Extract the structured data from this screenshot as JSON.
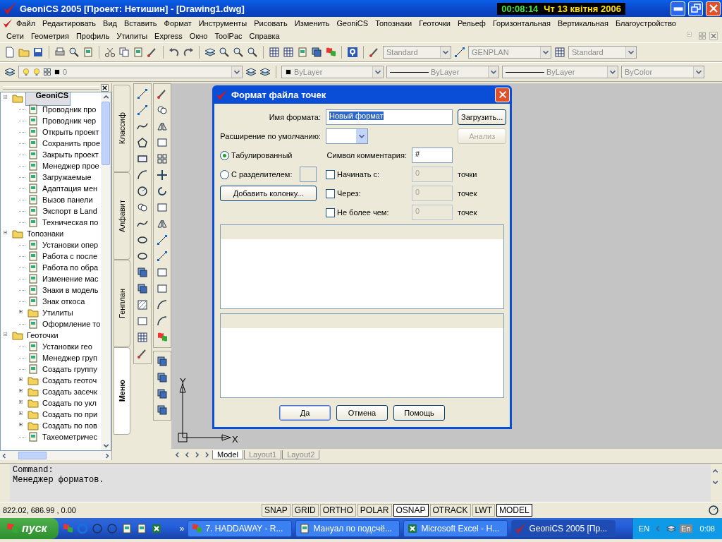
{
  "title_bar": {
    "title": "GeoniCS 2005 [Проект: Нетишин] - [Drawing1.dwg]",
    "clock_time": "00:08:14",
    "clock_date": "Чт 13 квітня 2006"
  },
  "menu_rows": [
    [
      "Файл",
      "Редактировать",
      "Вид",
      "Вставить",
      "Формат",
      "Инструменты",
      "Рисовать",
      "Изменить",
      "GeoniCS",
      "Топознаки",
      "Геоточки",
      "Рельеф",
      "Горизонтальная",
      "Вертикальная",
      "Благоустройство"
    ],
    [
      "Сети",
      "Геометрия",
      "Профиль",
      "Утилиты",
      "Express",
      "Окно",
      "ToolPac",
      "Справка"
    ]
  ],
  "toolbar": {
    "text_style": "Standard",
    "dim_style": "GENPLAN",
    "table_style": "Standard"
  },
  "layers_bar": {
    "layer": "0",
    "color_setting": "ByLayer",
    "linetype": "ByLayer",
    "lineweight": "ByLayer",
    "plot_style": "ByColor"
  },
  "tree": [
    {
      "label": "GeoniCS",
      "kind": "folder",
      "selected": true,
      "expanded": true,
      "children": [
        {
          "label": "Проводник про",
          "kind": "item",
          "selected": false
        },
        {
          "label": "Проводник чер",
          "kind": "item",
          "selected": false
        },
        {
          "label": "Открыть проект",
          "kind": "item",
          "selected": false
        },
        {
          "label": "Сохранить прое",
          "kind": "item",
          "selected": false
        },
        {
          "label": "Закрыть проект",
          "kind": "item",
          "selected": false
        },
        {
          "label": "Менеджер прое",
          "kind": "item",
          "selected": false
        },
        {
          "label": "Загружаемые",
          "kind": "item",
          "selected": false
        },
        {
          "label": "Адаптация мен",
          "kind": "item",
          "selected": false
        },
        {
          "label": "Вызов панели",
          "kind": "item",
          "selected": false
        },
        {
          "label": "Экспорт в Land",
          "kind": "item",
          "selected": false
        },
        {
          "label": "Техническая по",
          "kind": "item",
          "selected": false
        }
      ]
    },
    {
      "label": "Топознаки",
      "kind": "folder",
      "selected": false,
      "expanded": true,
      "children": [
        {
          "label": "Установки опер",
          "kind": "item",
          "selected": false
        },
        {
          "label": "Работа с после",
          "kind": "item",
          "selected": false
        },
        {
          "label": "Работа по обра",
          "kind": "item",
          "selected": false
        },
        {
          "label": "Изменение мас",
          "kind": "item",
          "selected": false
        },
        {
          "label": "Знаки в модель",
          "kind": "item",
          "selected": false
        },
        {
          "label": "Знак откоса",
          "kind": "item",
          "selected": false
        },
        {
          "label": "Утилиты",
          "kind": "folder",
          "selected": false,
          "expanded": false
        },
        {
          "label": "Оформление то",
          "kind": "item",
          "selected": false
        }
      ]
    },
    {
      "label": "Геоточки",
      "kind": "folder",
      "selected": false,
      "expanded": true,
      "children": [
        {
          "label": "Установки гео",
          "kind": "item",
          "selected": false
        },
        {
          "label": "Менеджер груп",
          "kind": "item",
          "selected": false
        },
        {
          "label": "Создать группу",
          "kind": "item",
          "selected": false
        },
        {
          "label": "Создать геоточ",
          "kind": "folder",
          "selected": false,
          "expanded": false
        },
        {
          "label": "Создать засечк",
          "kind": "folder",
          "selected": false,
          "expanded": false
        },
        {
          "label": "Создать по укл",
          "kind": "folder",
          "selected": false,
          "expanded": false
        },
        {
          "label": "Создать по при",
          "kind": "folder",
          "selected": false,
          "expanded": false
        },
        {
          "label": "Создать по пов",
          "kind": "folder",
          "selected": false,
          "expanded": false
        },
        {
          "label": "Тахеометричес",
          "kind": "item",
          "selected": false
        }
      ]
    }
  ],
  "side_tabs": [
    {
      "label": "Классиф",
      "selected": false
    },
    {
      "label": "Алфавит",
      "selected": false
    },
    {
      "label": "Генплан",
      "selected": false
    },
    {
      "label": "Меню",
      "selected": true
    }
  ],
  "canvas": {
    "ucs_y": "Y",
    "ucs_x": "X"
  },
  "layout_tabs": [
    {
      "label": "Model",
      "selected": true
    },
    {
      "label": "Layout1",
      "selected": false
    },
    {
      "label": "Layout2",
      "selected": false
    }
  ],
  "dialog": {
    "title": "Формат файла точек",
    "name_label": "Имя формата:",
    "name_value": "Новый формат",
    "name_selected": true,
    "load_button": "Загрузить...",
    "analyze_button": {
      "label": "Анализ",
      "disabled": true
    },
    "ext_label": "Расширение по умолчанию:",
    "format_options": [
      {
        "label": "Табулированный",
        "selected": true
      },
      {
        "label": "С разделителем:",
        "selected": false
      }
    ],
    "comment_label": "Символ комментария:",
    "comment_value": "#",
    "add_column_button": "Добавить колонку...",
    "limits": [
      {
        "label": "Начинать с:",
        "checked": false,
        "value": "0",
        "unit": "точки"
      },
      {
        "label": "Через:",
        "checked": false,
        "value": "0",
        "unit": "точек"
      },
      {
        "label": "Не более чем:",
        "checked": false,
        "value": "0",
        "unit": "точек"
      }
    ],
    "buttons": [
      {
        "label": "Да",
        "default": true
      },
      {
        "label": "Отмена",
        "default": false
      },
      {
        "label": "Помощь",
        "default": false
      }
    ]
  },
  "command_lines": [
    "Command:",
    "Менеджер форматов."
  ],
  "status_bar": {
    "coordinates": "822.02,  686.99  , 0.00",
    "toggles": [
      {
        "label": "SNAP",
        "on": false
      },
      {
        "label": "GRID",
        "on": false
      },
      {
        "label": "ORTHO",
        "on": false
      },
      {
        "label": "POLAR",
        "on": false
      },
      {
        "label": "OSNAP",
        "on": true
      },
      {
        "label": "OTRACK",
        "on": false
      },
      {
        "label": "LWT",
        "on": false
      },
      {
        "label": "MODEL",
        "on": true
      }
    ]
  },
  "taskbar": {
    "start": "пуск",
    "chevron": "»",
    "tasks": [
      {
        "label": "7. HADDAWAY - R...",
        "selected": false
      },
      {
        "label": "Мануал по подсчё...",
        "selected": false
      },
      {
        "label": "Microsoft Excel - Н...",
        "selected": false
      },
      {
        "label": "GeoniCS 2005 [Пр...",
        "selected": true
      }
    ],
    "tray": [
      "EN",
      "En"
    ],
    "time": "0:08"
  }
}
